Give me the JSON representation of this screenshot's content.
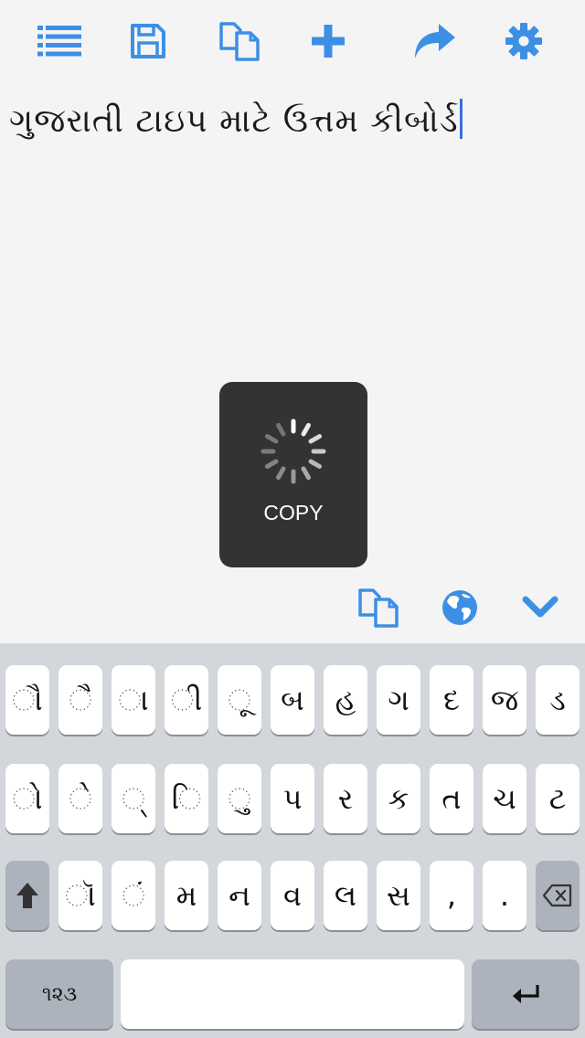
{
  "toolbar": {
    "icons": [
      "list-icon",
      "save-icon",
      "copy-icon",
      "plus-icon",
      "share-icon",
      "gear-icon"
    ],
    "accent_color": "#3d8fe5"
  },
  "editor": {
    "text": "ગુજરાતી ટાઇપ માટે ઉત્તમ કીબોર્ડ"
  },
  "hud": {
    "label": "COPY"
  },
  "accessory": {
    "icons": [
      "copy-icon",
      "globe-icon",
      "chevron-down-icon"
    ]
  },
  "keyboard": {
    "row1": [
      "ૌ",
      "ૈ",
      "ા",
      "ી",
      "ૂ",
      "બ",
      "હ",
      "ગ",
      "દ",
      "જ",
      "ડ"
    ],
    "row2": [
      "ો",
      "ે",
      "્",
      "િ",
      "ુ",
      "પ",
      "ર",
      "ક",
      "ત",
      "ચ",
      "ટ"
    ],
    "row3": [
      "ૉ",
      "ં",
      "મ",
      "ન",
      "વ",
      "લ",
      "સ",
      ",",
      "."
    ],
    "numbers_label": "૧૨૩",
    "shift_icon": "shift-arrow-icon",
    "backspace_icon": "backspace-icon",
    "return_icon": "return-arrow-icon",
    "key_color": "#ffffff",
    "function_key_color": "#adb3bc",
    "background_color": "#d3d6db"
  }
}
